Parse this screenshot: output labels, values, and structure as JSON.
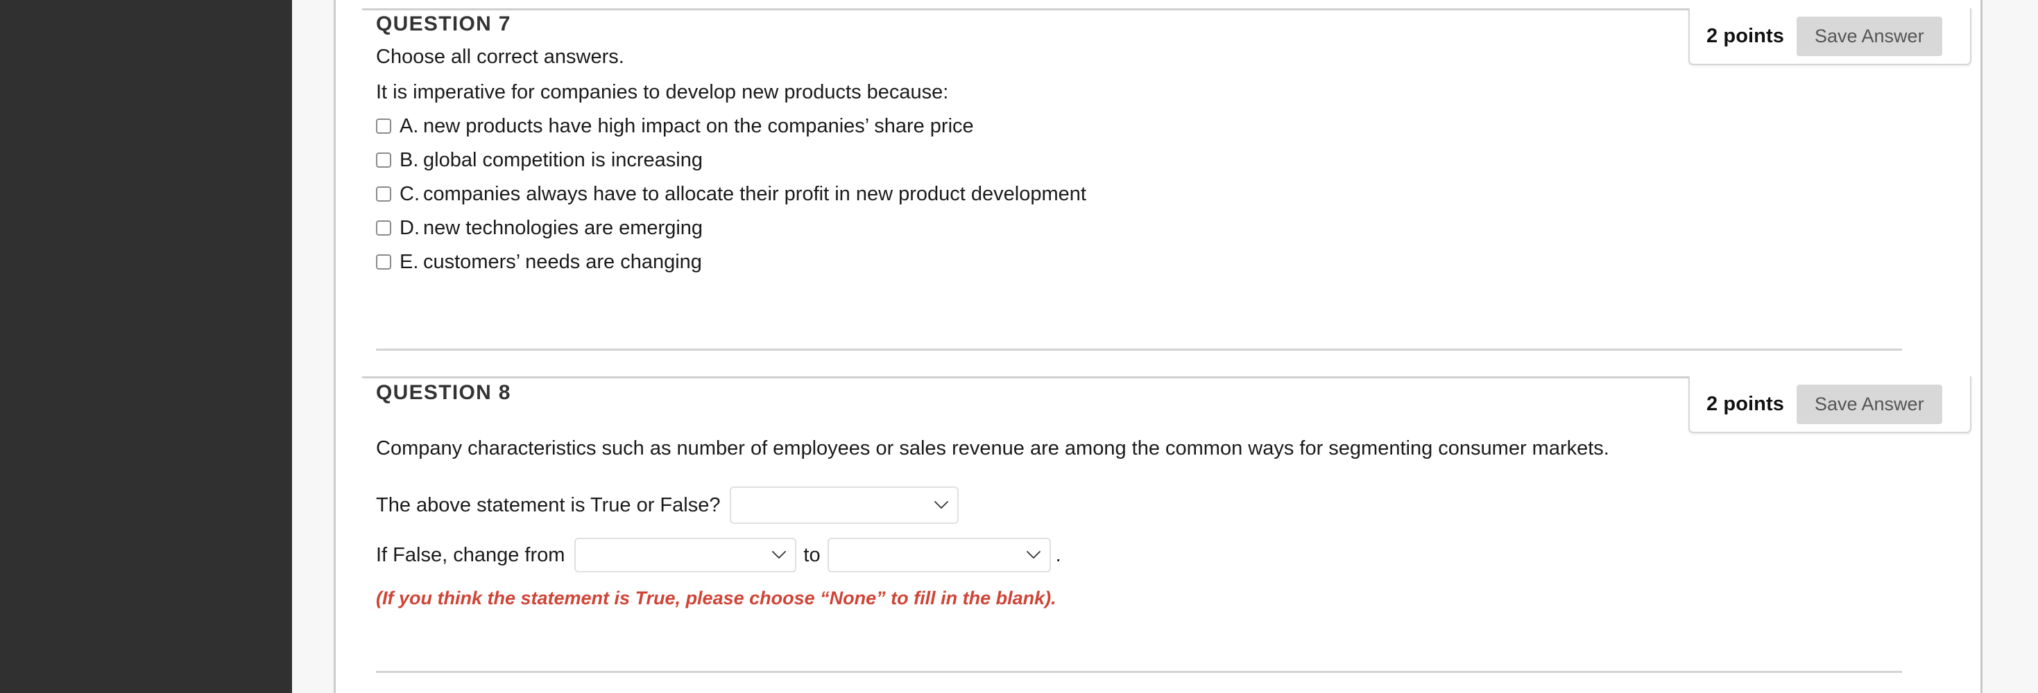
{
  "chrome": {
    "sidebar_color": "#303030",
    "rail_color": "#f7f7f7",
    "divider_color": "#cccccc",
    "content_bg": "#ffffff"
  },
  "questions": [
    {
      "id": "q7",
      "title": "QUESTION 7",
      "points_label": "2 points",
      "save_label": "Save Answer",
      "instruction": "Choose all correct answers.",
      "stem": "It is imperative for companies to develop new products because:",
      "choices": [
        {
          "letter": "A.",
          "text": "new products have high impact on the companies’ share price",
          "checked": false
        },
        {
          "letter": "B.",
          "text": "global competition is increasing",
          "checked": false
        },
        {
          "letter": "C.",
          "text": "companies always have to allocate their profit in new product development",
          "checked": false
        },
        {
          "letter": "D.",
          "text": "new technologies are emerging",
          "checked": false
        },
        {
          "letter": "E.",
          "text": "customers’ needs are changing",
          "checked": false
        }
      ]
    },
    {
      "id": "q8",
      "title": "QUESTION 8",
      "points_label": "2 points",
      "save_label": "Save Answer",
      "stem": "Company characteristics such as number of employees or sales revenue are among the common ways for segmenting consumer markets.",
      "truefalse_label": "The above statement is True or False?",
      "truefalse_value": "",
      "change_label": "If False, change from",
      "change_from_value": "",
      "change_mid_label": "to",
      "change_to_value": "",
      "change_period": ".",
      "hint": "(If you think the statement is True, please choose “None” to fill in the blank).",
      "hint_color": "#cf4436"
    }
  ]
}
